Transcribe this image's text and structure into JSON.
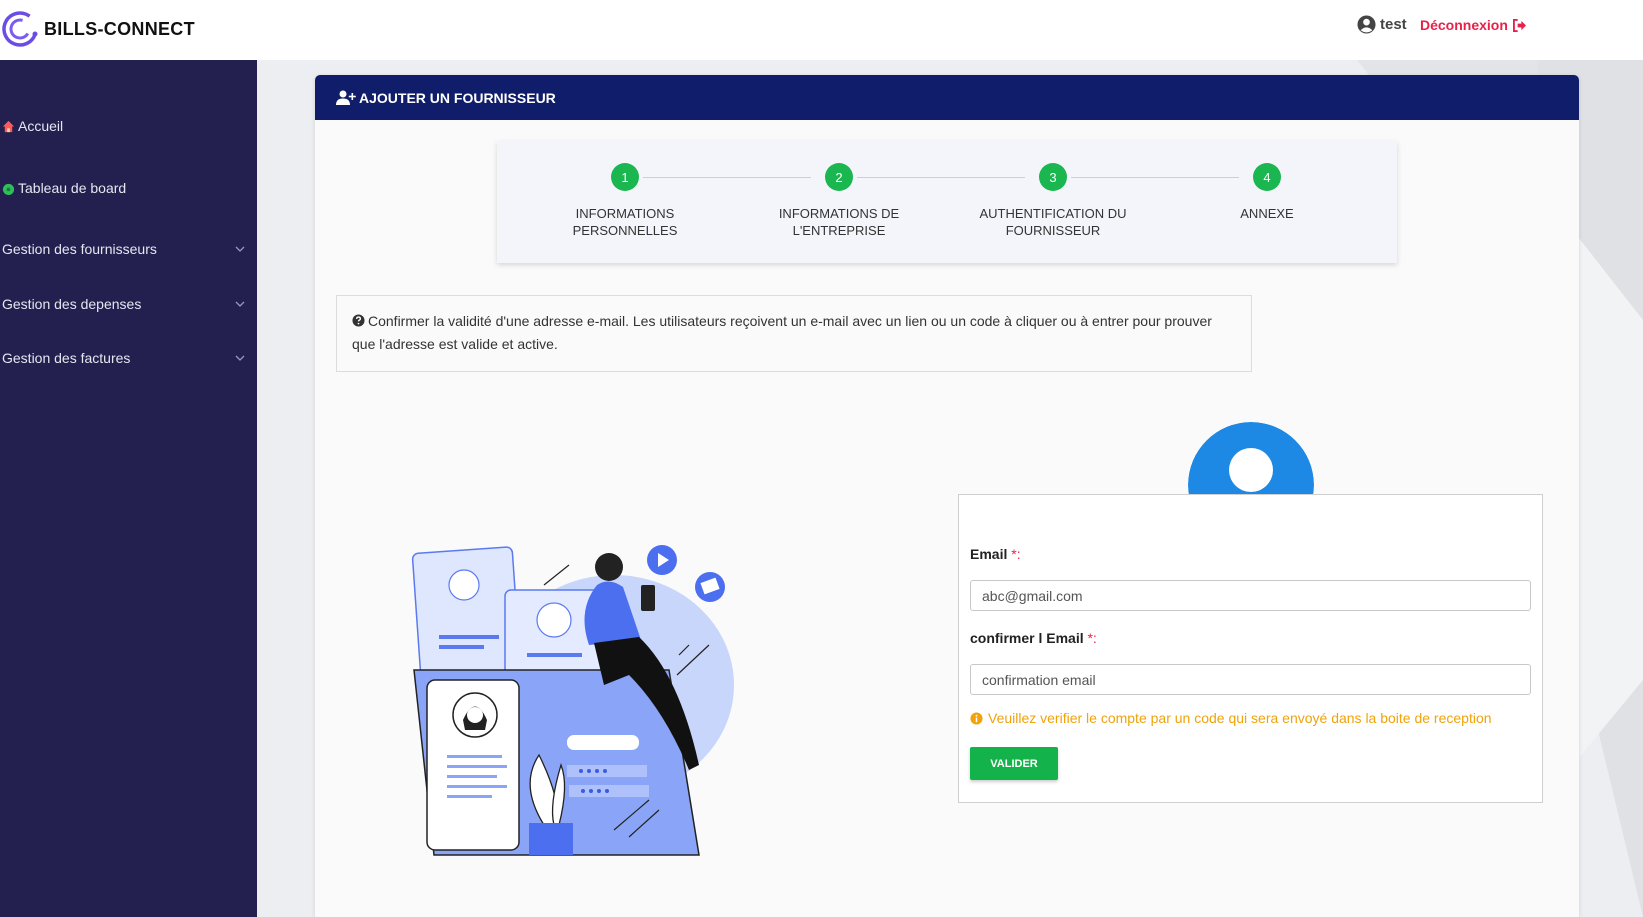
{
  "app": {
    "name": "BILLS-CONNECT"
  },
  "header": {
    "user": "test",
    "logout": "Déconnexion"
  },
  "sidebar": {
    "items": [
      {
        "label": "Accueil"
      },
      {
        "label": "Tableau de board"
      },
      {
        "label": "Gestion des fournisseurs"
      },
      {
        "label": "Gestion des depenses"
      },
      {
        "label": "Gestion des factures"
      }
    ]
  },
  "card": {
    "title": "AJOUTER UN FOURNISSEUR"
  },
  "stepper": {
    "steps": [
      {
        "num": "1",
        "line1": "INFORMATIONS",
        "line2": "PERSONNELLES"
      },
      {
        "num": "2",
        "line1": "INFORMATIONS DE",
        "line2": "L'ENTREPRISE"
      },
      {
        "num": "3",
        "line1": "AUTHENTIFICATION DU",
        "line2": "FOURNISSEUR"
      },
      {
        "num": "4",
        "line1": "ANNEXE",
        "line2": ""
      }
    ]
  },
  "info": {
    "text": "Confirmer la validité d'une adresse e-mail. Les utilisateurs reçoivent un e-mail avec un lien ou un code à cliquer ou à entrer pour prouver que l'adresse est valide et active."
  },
  "form": {
    "email_label": "Email",
    "email_required": "*:",
    "email_placeholder": "abc@gmail.com",
    "confirm_label": "confirmer l Email",
    "confirm_required": "*:",
    "confirm_placeholder": "confirmation email",
    "warning": "Veuillez verifier le compte par un code qui sera envoyé dans la boite de reception",
    "submit": "VALIDER"
  },
  "colors": {
    "sidebar": "#23204f",
    "header": "#0f1d6b",
    "step": "#1ab64f",
    "logout": "#e8214a",
    "warning": "#f0a30a",
    "avatar": "#1e88e5"
  }
}
